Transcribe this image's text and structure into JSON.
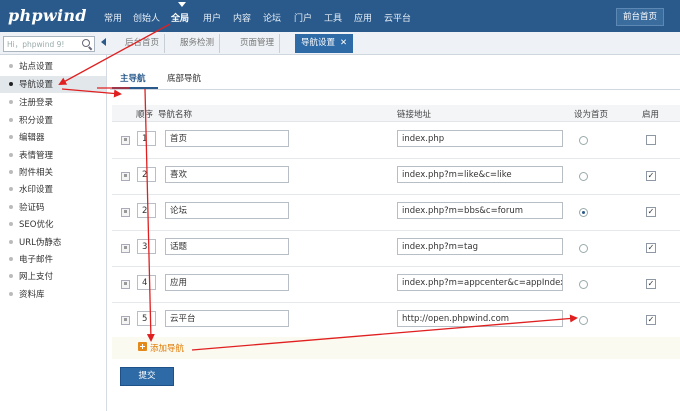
{
  "header": {
    "logo": "phpwind",
    "nav": [
      "常用",
      "创始人",
      "全局",
      "用户",
      "内容",
      "论坛",
      "门户",
      "工具",
      "应用",
      "云平台"
    ],
    "front_page": "前台首页"
  },
  "search": {
    "value": "Hi，phpwind 9!"
  },
  "tabs": [
    "后台首页",
    "服务检测",
    "页面管理",
    "导航设置"
  ],
  "sidebar": {
    "items": [
      "站点设置",
      "导航设置",
      "注册登录",
      "积分设置",
      "编辑器",
      "表情管理",
      "附件相关",
      "水印设置",
      "验证码",
      "SEO优化",
      "URL伪静态",
      "电子邮件",
      "网上支付",
      "资料库"
    ]
  },
  "subtabs": {
    "main": "主导航",
    "bottom": "底部导航"
  },
  "table": {
    "headers": {
      "order": "顺序",
      "name": "导航名称",
      "url": "链接地址",
      "home": "设为首页",
      "enable": "启用"
    },
    "rows": [
      {
        "order": "1",
        "name": "首页",
        "url": "index.php",
        "home": false,
        "enabled": false
      },
      {
        "order": "2",
        "name": "喜欢",
        "url": "index.php?m=like&c=like",
        "home": false,
        "enabled": true
      },
      {
        "order": "2",
        "name": "论坛",
        "url": "index.php?m=bbs&c=forum",
        "home": true,
        "enabled": true
      },
      {
        "order": "3",
        "name": "话题",
        "url": "index.php?m=tag",
        "home": false,
        "enabled": true
      },
      {
        "order": "4",
        "name": "应用",
        "url": "index.php?m=appcenter&c=appIndex",
        "home": false,
        "enabled": true
      },
      {
        "order": "5",
        "name": "云平台",
        "url": "http://open.phpwind.com",
        "home": false,
        "enabled": true
      }
    ]
  },
  "add_nav": "添加导航",
  "submit": "提交",
  "colors": {
    "topbar": "#2a5a8c",
    "accent": "#2d6aa6",
    "annotation": "#e02020",
    "add": "#e07a00"
  }
}
